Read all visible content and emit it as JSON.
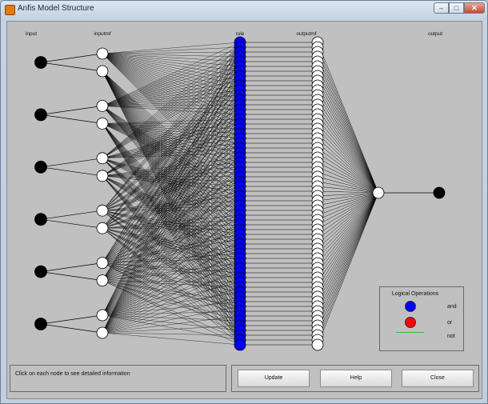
{
  "window": {
    "title": "Anfis Model Structure",
    "minimize": "–",
    "maximize": "□",
    "close": "✕"
  },
  "diagram": {
    "columns": {
      "input": "input",
      "inputmf": "inputmf",
      "rule": "rule",
      "outputmf": "outputmf",
      "output": "output"
    },
    "counts": {
      "inputs": 6,
      "mfs_per_input": 2,
      "rules": 64,
      "outputmfs": 64,
      "outputs": 1
    },
    "colors": {
      "input_node": "#000000",
      "mf_node": "#ffffff",
      "rule_node": "#0000ff",
      "edge": "#000000"
    }
  },
  "status": {
    "text": "Click on each node to see detailed information"
  },
  "buttons": {
    "update": "Update",
    "help": "Help",
    "close": "Close"
  },
  "legend": {
    "title": "Logical Operations",
    "items": [
      {
        "label": "and",
        "color": "#0000ff"
      },
      {
        "label": "or",
        "color": "#ff0000"
      },
      {
        "label": "not",
        "color": "#3dbb3d"
      }
    ]
  }
}
